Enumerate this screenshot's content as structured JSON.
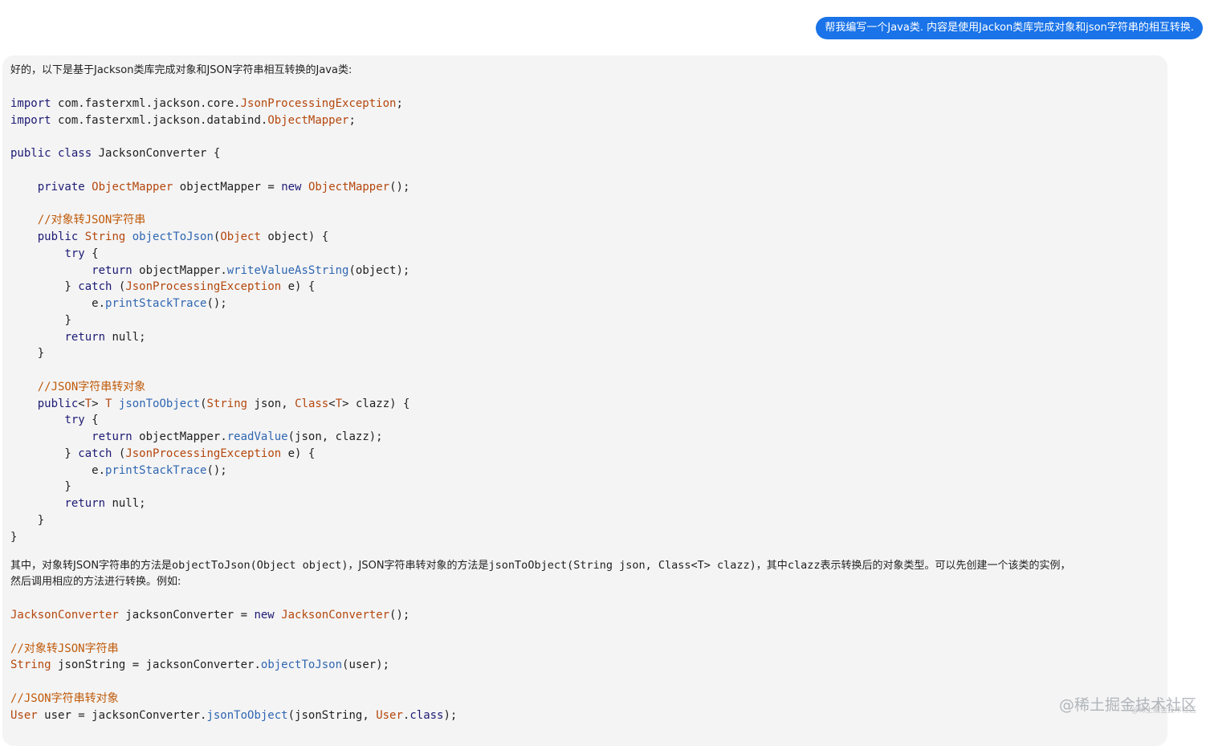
{
  "user_message": "帮我编写一个Java类. 内容是使用Jackon类库完成对象和json字符串的相互转换.",
  "reply": {
    "intro": "好的，以下是基于Jackson类库完成对象和JSON字符串相互转换的Java类:",
    "code1": [
      [
        [
          "kw",
          "import"
        ],
        [
          "",
          "com.fasterxml.jackson.core."
        ],
        [
          "ty",
          "JsonProcessingException"
        ],
        [
          "",
          ";"
        ]
      ],
      [
        [
          "kw",
          "import"
        ],
        [
          "",
          "com.fasterxml.jackson.databind."
        ],
        [
          "ty",
          "ObjectMapper"
        ],
        [
          "",
          ";"
        ]
      ],
      [],
      [
        [
          "kw",
          "public class"
        ],
        [
          "",
          "JacksonConverter {"
        ]
      ],
      [],
      [
        [
          "",
          "    "
        ],
        [
          "kw",
          "private"
        ],
        [
          "",
          "ObjectMapper",
          "ty"
        ],
        [
          "",
          "objectMapper = "
        ],
        [
          "kw",
          "new"
        ],
        [
          "ty",
          "ObjectMapper"
        ],
        [
          "",
          "();"
        ]
      ],
      [],
      [
        [
          "cm",
          "    //对象转JSON字符串"
        ]
      ],
      [
        [
          "",
          "    "
        ],
        [
          "kw",
          "public"
        ],
        [
          "ty",
          "String"
        ],
        [
          "fn",
          "objectToJson"
        ],
        [
          "",
          "("
        ],
        [
          "ty",
          "Object"
        ],
        [
          "",
          "object) {"
        ]
      ],
      [
        [
          "",
          "        "
        ],
        [
          "kw",
          "try"
        ],
        [
          "",
          " {"
        ]
      ],
      [
        [
          "",
          "            "
        ],
        [
          "kw",
          "return"
        ],
        [
          "",
          "objectMapper."
        ],
        [
          "fn",
          "writeValueAsString"
        ],
        [
          "",
          "(object);"
        ]
      ],
      [
        [
          "",
          "        } "
        ],
        [
          "kw",
          "catch"
        ],
        [
          "",
          " ("
        ],
        [
          "ty",
          "JsonProcessingException"
        ],
        [
          "",
          "e) {"
        ]
      ],
      [
        [
          "",
          "            e."
        ],
        [
          "fn",
          "printStackTrace"
        ],
        [
          "",
          "();"
        ]
      ],
      [
        [
          "",
          "        "
        ],
        [
          "",
          "}"
        ]
      ],
      [
        [
          "",
          "        "
        ],
        [
          "kw",
          "return"
        ],
        [
          "",
          "null;"
        ]
      ],
      [
        [
          "",
          "    }"
        ]
      ],
      [],
      [
        [
          "cm",
          "    //JSON字符串转对象"
        ]
      ],
      [
        [
          "",
          "    "
        ],
        [
          "kw",
          "public"
        ],
        [
          "",
          "<"
        ],
        [
          "ty",
          "T"
        ],
        [
          "",
          "> "
        ],
        [
          "ty",
          "T"
        ],
        [
          "fn",
          "jsonToObject"
        ],
        [
          "",
          "("
        ],
        [
          "ty",
          "String"
        ],
        [
          "",
          "json, "
        ],
        [
          "ty",
          "Class"
        ],
        [
          "",
          "<"
        ],
        [
          "ty",
          "T"
        ],
        [
          "",
          "> clazz) {"
        ]
      ],
      [
        [
          "",
          "        "
        ],
        [
          "kw",
          "try"
        ],
        [
          "",
          " {"
        ]
      ],
      [
        [
          "",
          "            "
        ],
        [
          "kw",
          "return"
        ],
        [
          "",
          "objectMapper."
        ],
        [
          "fn",
          "readValue"
        ],
        [
          "",
          "(json, clazz);"
        ]
      ],
      [
        [
          "",
          "        } "
        ],
        [
          "kw",
          "catch"
        ],
        [
          "",
          " ("
        ],
        [
          "ty",
          "JsonProcessingException"
        ],
        [
          "",
          "e) {"
        ]
      ],
      [
        [
          "",
          "            e."
        ],
        [
          "fn",
          "printStackTrace"
        ],
        [
          "",
          "();"
        ]
      ],
      [
        [
          "",
          "        }"
        ]
      ],
      [
        [
          "",
          "        "
        ],
        [
          "kw",
          "return"
        ],
        [
          "",
          "null;"
        ]
      ],
      [
        [
          "",
          "    }"
        ]
      ],
      [
        [
          "",
          "}"
        ]
      ]
    ],
    "explanation_line1_a": "其中，对象转JSON字符串的方法是",
    "explanation_code_a": "objectToJson(Object object)",
    "explanation_line1_b": "，JSON字符串转对象的方法是",
    "explanation_code_b": "jsonToObject(String json, Class<T> clazz)",
    "explanation_line1_c": "，其中",
    "explanation_code_c": "clazz",
    "explanation_line1_d": "表示转换后的对象类型。可以先创建一个该类的实例，",
    "explanation_line2": "然后调用相应的方法进行转换。例如:",
    "code2": [
      [
        [
          "ty",
          "JacksonConverter"
        ],
        [
          "",
          "jacksonConverter = "
        ],
        [
          "kw",
          "new"
        ],
        [
          "ty",
          "JacksonConverter"
        ],
        [
          "",
          "();"
        ]
      ],
      [],
      [
        [
          "cm",
          "//对象转JSON字符串"
        ]
      ],
      [
        [
          "ty",
          "String"
        ],
        [
          "",
          "jsonString = jacksonConverter."
        ],
        [
          "fn",
          "objectToJson"
        ],
        [
          "",
          "(user);"
        ]
      ],
      [],
      [
        [
          "cm",
          "//JSON字符串转对象"
        ]
      ],
      [
        [
          "ty",
          "User"
        ],
        [
          "",
          "user = jacksonConverter."
        ],
        [
          "fn",
          "jsonToObject"
        ],
        [
          "",
          "(jsonString, "
        ],
        [
          "ty",
          "User"
        ],
        [
          "",
          "."
        ],
        [
          "kw",
          "class"
        ],
        [
          "",
          ");"
        ]
      ]
    ]
  },
  "watermark": "@稀土掘金技术社区",
  "watermark_small": "@稀土掘金技术社区"
}
